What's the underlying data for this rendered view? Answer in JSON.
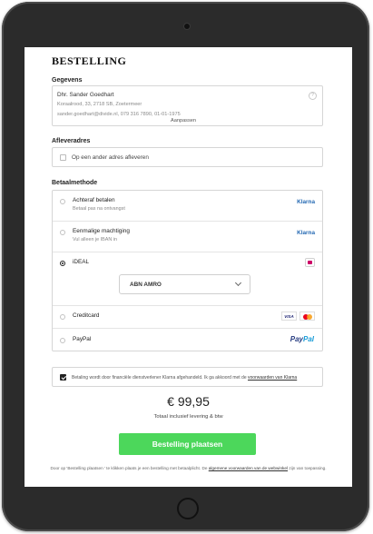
{
  "page": {
    "title": "BESTELLING"
  },
  "gegevens": {
    "section_title": "Gegevens",
    "name": "Dhr. Sander Goedhart",
    "address": "Koraalrood, 33, 2718 SB, Zoetermeer",
    "contact": "sander.goedhart@divide.nl, 079 316 7890, 01-01-1975",
    "edit_label": "Aanpassen",
    "info_icon": "info-icon"
  },
  "afleveradres": {
    "section_title": "Afleveradres",
    "checkbox_label": "Op een ander adres afleveren",
    "checked": false
  },
  "betaalmethode": {
    "section_title": "Betaalmethode",
    "methods": [
      {
        "name": "Achteraf betalen",
        "sub": "Betaal pas na ontvangst",
        "logo": "Klarna",
        "selected": false
      },
      {
        "name": "Eenmalige machtiging",
        "sub": "Vul alleen je IBAN in",
        "logo": "Klarna",
        "selected": false
      },
      {
        "name": "iDEAL",
        "sub": "",
        "logo": "ideal-icon",
        "selected": true
      },
      {
        "name": "Creditcard",
        "sub": "",
        "logo": "visa-mastercard-icons",
        "selected": false
      },
      {
        "name": "PayPal",
        "sub": "",
        "logo": "PayPal",
        "selected": false
      }
    ],
    "bank_select": {
      "selected": "ABN AMRO"
    },
    "visa_text": "VISA",
    "paypal_pay": "Pay",
    "paypal_pal": "Pal"
  },
  "agreement": {
    "checked": true,
    "text": "Betaling wordt door financiële dienstverlener Klarna afgehandeld. Ik ga akkoord met de ",
    "link": "voorwaarden van Klarna"
  },
  "summary": {
    "total": "€ 99,95",
    "subtitle": "Totaal inclusief levering & btw"
  },
  "cta": {
    "label": "Bestelling plaatsen"
  },
  "footer": {
    "text_before": "Door op 'Bestelling plaatsen ' te klikken plaats je een bestelling met betaalplicht. De ",
    "link": "algemene voorwaarden van de webwinkel",
    "text_after": " zijn van toepassing."
  },
  "colors": {
    "accent": "#4cd75b",
    "klarna": "#2469b3",
    "ideal": "#cc0066"
  }
}
